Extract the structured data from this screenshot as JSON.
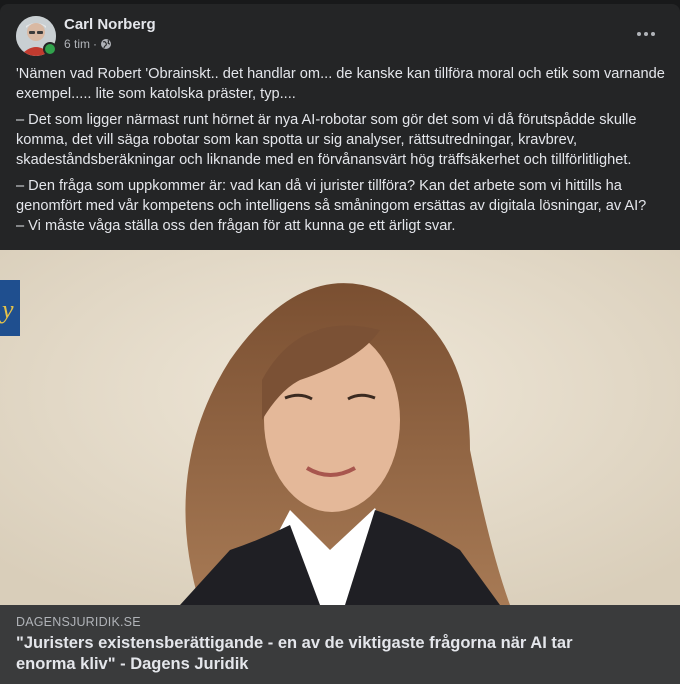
{
  "post": {
    "author": "Carl Norberg",
    "time": "6 tim",
    "separator": "·",
    "privacy_icon": "globe-icon",
    "more_icon": "more-horizontal-icon",
    "online_color": "#31a24c",
    "paragraphs": [
      "'Nämen vad Robert 'Obrainskt.. det handlar om... de kanske kan tillföra moral och etik som varnande exempel..... lite som katolska präster, typ....",
      "– Det som ligger närmast runt hörnet är nya AI-robotar som gör det som vi då förutspådde skulle komma, det vill säga robotar som kan spotta ur sig analyser, rättsutredningar, kravbrev, skadeståndsberäkningar och liknande med en förvånansvärt hög träffsäkerhet och tillförlitlighet.",
      "– Den fråga som uppkommer är: vad kan då vi jurister tillföra? Kan det arbete som vi hittills ha genomfört med vår kompetens och intelligens så småningom ersättas av digitala lösningar, av AI?\n– Vi måste våga ställa oss den frågan för att kunna ge ett ärligt svar."
    ]
  },
  "link_preview": {
    "domain": "DAGENSJURIDIK.SE",
    "title": "\"Juristers existensberättigande - en av de viktigaste frågorna när AI tar enorma kliv\" - Dagens Juridik"
  }
}
